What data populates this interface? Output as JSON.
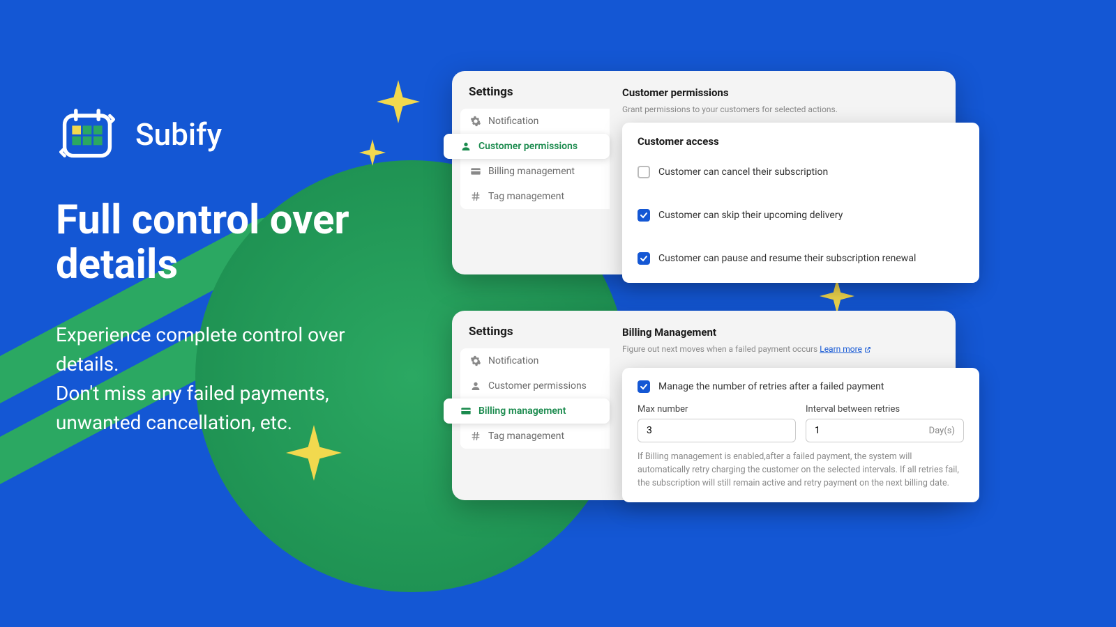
{
  "brand": {
    "name": "Subify"
  },
  "hero": {
    "headline": "Full control over details",
    "sub1": "Experience complete control over details.",
    "sub2": "Don't miss any failed payments, unwanted cancellation, etc."
  },
  "card_perm": {
    "sidebar_title": "Settings",
    "items": [
      {
        "label": "Notification"
      },
      {
        "label": "Customer permissions"
      },
      {
        "label": "Billing management"
      },
      {
        "label": "Tag management"
      }
    ],
    "content_title": "Customer permissions",
    "content_sub": "Grant permissions to your customers for selected actions.",
    "panel_title": "Customer access",
    "checks": [
      {
        "label": "Customer can cancel their subscription",
        "checked": false
      },
      {
        "label": "Customer can skip their upcoming delivery",
        "checked": true
      },
      {
        "label": "Customer can pause and resume their subscription renewal",
        "checked": true
      }
    ]
  },
  "card_bill": {
    "sidebar_title": "Settings",
    "items": [
      {
        "label": "Notification"
      },
      {
        "label": "Customer permissions"
      },
      {
        "label": "Billing management"
      },
      {
        "label": "Tag management"
      }
    ],
    "content_title": "Billing Management",
    "content_sub_pre": "Figure out next moves when a failed payment occurs ",
    "content_link": "Learn more",
    "panel_check": "Manage the number of retries after a failed payment",
    "max_label": "Max number",
    "max_value": "3",
    "interval_label": "Interval between retries",
    "interval_value": "1",
    "interval_suffix": "Day(s)",
    "help": "If Billing management is enabled,after a failed payment, the system will automatically retry charging the customer on the selected intervals. If all retries fail, the subscription will still remain active and retry payment on the next billing date."
  }
}
